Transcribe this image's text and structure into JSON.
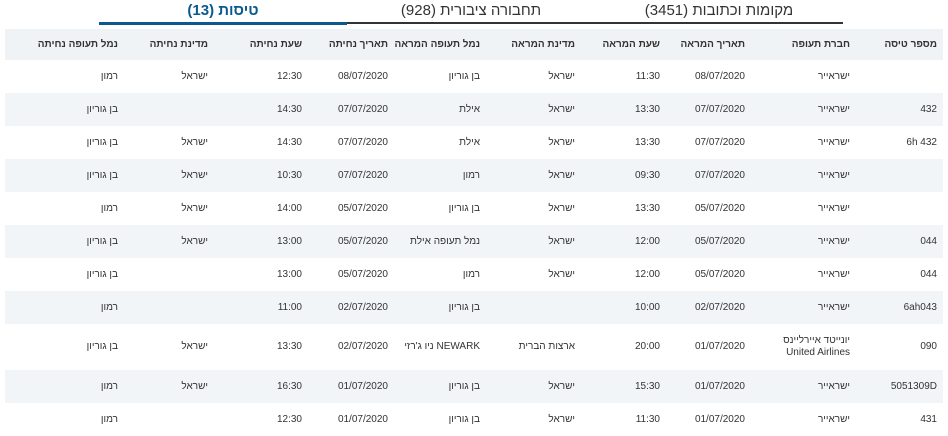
{
  "tabs": [
    {
      "label": "מקומות וכתובות (3451)",
      "active": false
    },
    {
      "label": "תחבורה ציבורית (928)",
      "active": false
    },
    {
      "label": "טיסות (13)",
      "active": true
    }
  ],
  "table": {
    "headers": [
      "מספר טיסה",
      "חברת תעופה",
      "תאריך המראה",
      "שעת המראה",
      "מדינת המראה",
      "נמל תעופה המראה",
      "תאריך נחיתה",
      "שעת נחיתה",
      "מדינת נחיתה",
      "נמל תעופה נחיתה"
    ],
    "rows": [
      [
        "",
        "ישראייר",
        "08/07/2020",
        "11:30",
        "ישראל",
        "בן גוריון",
        "08/07/2020",
        "12:30",
        "ישראל",
        "רמון"
      ],
      [
        "432",
        "ישראייר",
        "07/07/2020",
        "13:30",
        "ישראל",
        "אילת",
        "07/07/2020",
        "14:30",
        "",
        "בן גוריון"
      ],
      [
        "6h 432",
        "ישראייר",
        "07/07/2020",
        "13:30",
        "ישראל",
        "אילת",
        "07/07/2020",
        "14:30",
        "ישראל",
        "בן גוריון"
      ],
      [
        "",
        "ישראייר",
        "07/07/2020",
        "09:30",
        "ישראל",
        "רמון",
        "07/07/2020",
        "10:30",
        "ישראל",
        "בן גוריון"
      ],
      [
        "",
        "ישראייר",
        "05/07/2020",
        "13:30",
        "ישראל",
        "בן גוריון",
        "05/07/2020",
        "14:00",
        "ישראל",
        "רמון"
      ],
      [
        "044",
        "ישראייר",
        "05/07/2020",
        "12:00",
        "ישראל",
        "נמל תעופה אילת",
        "05/07/2020",
        "13:00",
        "ישראל",
        "בן גוריון"
      ],
      [
        "044",
        "ישראייר",
        "05/07/2020",
        "12:00",
        "ישראל",
        "רמון",
        "05/07/2020",
        "13:00",
        "",
        "בן גוריון"
      ],
      [
        "6ah043",
        "ישראייר",
        "02/07/2020",
        "10:00",
        "",
        "בן גוריון",
        "02/07/2020",
        "11:00",
        "",
        "רמון"
      ],
      [
        "090",
        "יונייטד איירליינס United Airlines",
        "01/07/2020",
        "20:00",
        "ארצות הברית",
        "NEWARK ניו ג'רזי",
        "02/07/2020",
        "13:30",
        "ישראל",
        "בן גוריון"
      ],
      [
        "5051309D",
        "ישראייר",
        "01/07/2020",
        "15:30",
        "ישראל",
        "בן גוריון",
        "01/07/2020",
        "16:30",
        "ישראל",
        "רמון"
      ],
      [
        "431",
        "ישראייר",
        "01/07/2020",
        "11:30",
        "ישראל",
        "בן גוריון",
        "01/07/2020",
        "12:30",
        "",
        "רמון"
      ]
    ]
  },
  "colors": {
    "active_tab": "#0a5a8f",
    "header_bg": "#f0f3f6",
    "stripe_bg": "#f2f5f8",
    "text": "#333333"
  }
}
